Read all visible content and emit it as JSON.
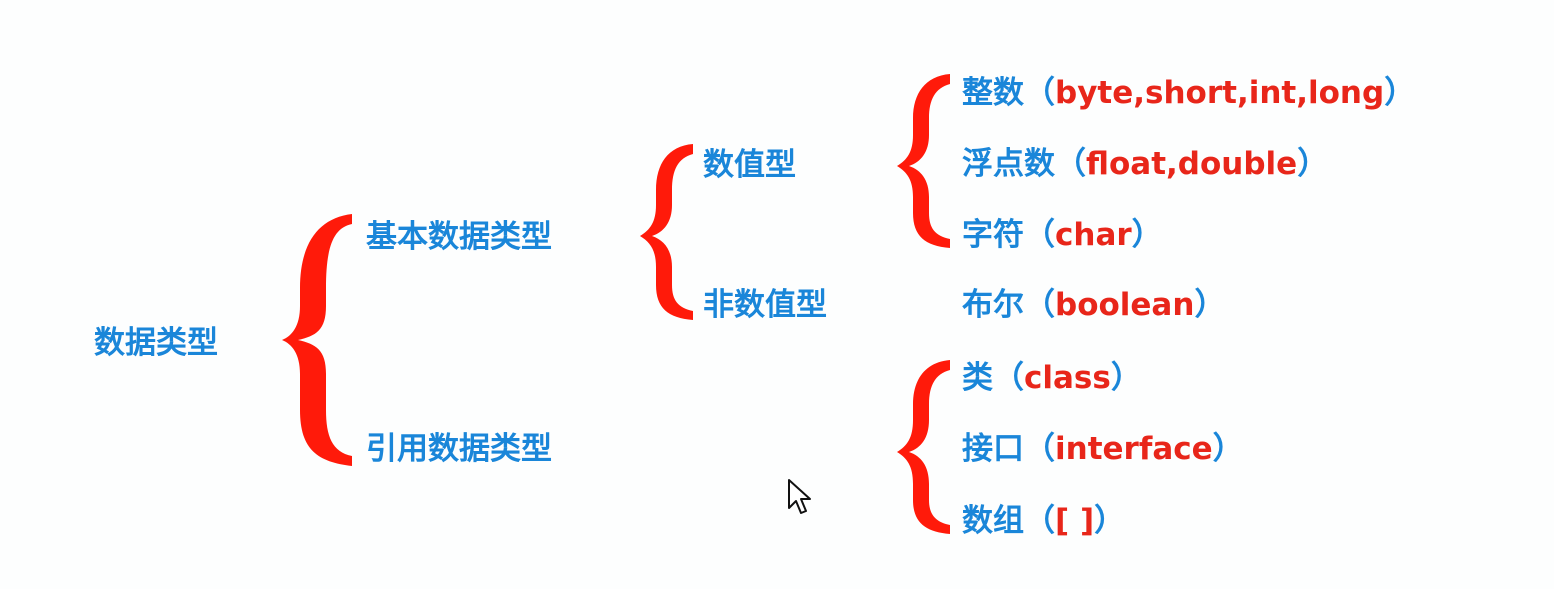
{
  "root": "数据类型",
  "primitive": "基本数据类型",
  "reference": "引用数据类型",
  "numeric": "数值型",
  "non_numeric": "非数值型",
  "open_paren": "（",
  "close_paren": "）",
  "integer": {
    "label": "整数",
    "types": "byte,short,int,long"
  },
  "floating": {
    "label": "浮点数",
    "types": "float,double"
  },
  "character": {
    "label": "字符",
    "types": "char"
  },
  "boolean": {
    "label": "布尔",
    "types": "boolean"
  },
  "class_type": {
    "label": "类",
    "types": "class"
  },
  "interface_type": {
    "label": "接口",
    "types": "interface"
  },
  "array_type": {
    "label": "数组",
    "types": "[ ]"
  },
  "colors": {
    "label": "#1a86d9",
    "keyword": "#e8261a",
    "brace": "#ff1a0a"
  }
}
